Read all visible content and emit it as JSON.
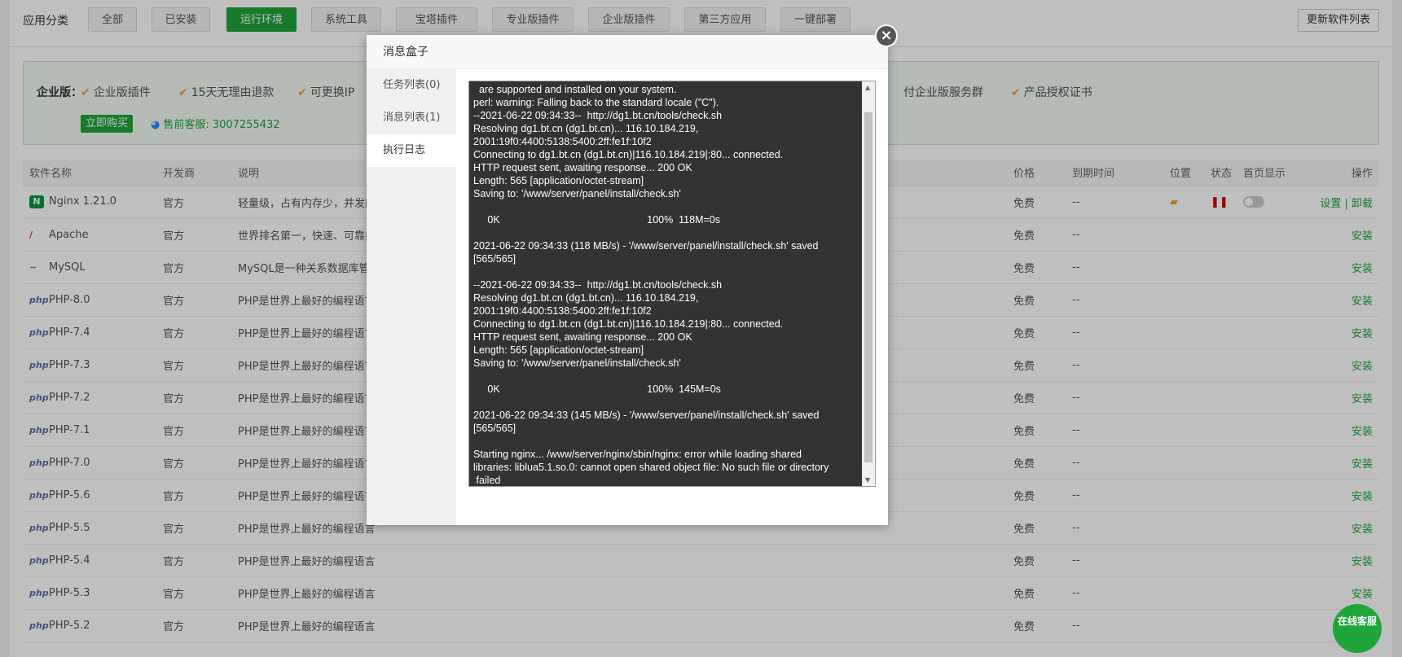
{
  "topbar": {
    "label": "应用分类",
    "categories": [
      "全部",
      "已安装",
      "运行环境",
      "系统工具",
      "宝塔插件",
      "专业版插件",
      "企业版插件",
      "第三方应用",
      "一键部署"
    ],
    "update_button": "更新软件列表"
  },
  "enterprise": {
    "title": "企业版：",
    "features": [
      "企业版插件",
      "15天无理由退款",
      "可更换IP",
      "付企业版服务群",
      "产品授权证书"
    ],
    "buy_button": "立即购买",
    "service": "售前客服: 3007255432"
  },
  "table": {
    "headers": [
      "软件名称",
      "开发商",
      "说明",
      "价格",
      "到期时间",
      "位置",
      "状态",
      "首页显示",
      "操作"
    ],
    "rows": [
      {
        "icon": "N",
        "name": "Nginx 1.21.0",
        "dev": "官方",
        "desc": "轻量级，占有内存少，并发能",
        "price": "免费",
        "expire": "--",
        "action": "设置 | 卸载"
      },
      {
        "icon": "/",
        "name": "Apache",
        "dev": "官方",
        "desc": "世界排名第一，快速、可靠并",
        "price": "免费",
        "expire": "--",
        "action": "安装"
      },
      {
        "icon": "~",
        "name": "MySQL",
        "dev": "官方",
        "desc": "MySQL是一种关系数据库管理",
        "price": "免费",
        "expire": "--",
        "action": "安装"
      },
      {
        "icon": "php",
        "name": "PHP-8.0",
        "dev": "官方",
        "desc": "PHP是世界上最好的编程语言",
        "price": "免费",
        "expire": "--",
        "action": "安装"
      },
      {
        "icon": "php",
        "name": "PHP-7.4",
        "dev": "官方",
        "desc": "PHP是世界上最好的编程语言",
        "price": "免费",
        "expire": "--",
        "action": "安装"
      },
      {
        "icon": "php",
        "name": "PHP-7.3",
        "dev": "官方",
        "desc": "PHP是世界上最好的编程语言",
        "price": "免费",
        "expire": "--",
        "action": "安装"
      },
      {
        "icon": "php",
        "name": "PHP-7.2",
        "dev": "官方",
        "desc": "PHP是世界上最好的编程语言",
        "price": "免费",
        "expire": "--",
        "action": "安装"
      },
      {
        "icon": "php",
        "name": "PHP-7.1",
        "dev": "官方",
        "desc": "PHP是世界上最好的编程语言",
        "price": "免费",
        "expire": "--",
        "action": "安装"
      },
      {
        "icon": "php",
        "name": "PHP-7.0",
        "dev": "官方",
        "desc": "PHP是世界上最好的编程语言",
        "price": "免费",
        "expire": "--",
        "action": "安装"
      },
      {
        "icon": "php",
        "name": "PHP-5.6",
        "dev": "官方",
        "desc": "PHP是世界上最好的编程语言",
        "price": "免费",
        "expire": "--",
        "action": "安装"
      },
      {
        "icon": "php",
        "name": "PHP-5.5",
        "dev": "官方",
        "desc": "PHP是世界上最好的编程语言",
        "price": "免费",
        "expire": "--",
        "action": "安装"
      },
      {
        "icon": "php",
        "name": "PHP-5.4",
        "dev": "官方",
        "desc": "PHP是世界上最好的编程语言",
        "price": "免费",
        "expire": "--",
        "action": "安装"
      },
      {
        "icon": "php",
        "name": "PHP-5.3",
        "dev": "官方",
        "desc": "PHP是世界上最好的编程语言",
        "price": "免费",
        "expire": "--",
        "action": "安装"
      },
      {
        "icon": "php",
        "name": "PHP-5.2",
        "dev": "官方",
        "desc": "PHP是世界上最好的编程语言",
        "price": "免费",
        "expire": "--",
        "action": "安装"
      }
    ]
  },
  "modal": {
    "title": "消息盒子",
    "tabs": [
      "任务列表(0)",
      "消息列表(1)",
      "执行日志"
    ],
    "active_tab": 2,
    "log_lines": [
      "  are supported and installed on your system.",
      "perl: warning: Falling back to the standard locale (\"C\").",
      "--2021-06-22 09:34:33--  http://dg1.bt.cn/tools/check.sh",
      "Resolving dg1.bt.cn (dg1.bt.cn)... 116.10.184.219,",
      "2001:19f0:4400:5138:5400:2ff:fe1f:10f2",
      "Connecting to dg1.bt.cn (dg1.bt.cn)|116.10.184.219|:80... connected.",
      "HTTP request sent, awaiting response... 200 OK",
      "Length: 565 [application/octet-stream]",
      "Saving to: '/www/server/panel/install/check.sh'",
      "",
      "     0K                                                    100%  118M=0s",
      "",
      "2021-06-22 09:34:33 (118 MB/s) - '/www/server/panel/install/check.sh' saved",
      "[565/565]",
      "",
      "--2021-06-22 09:34:33--  http://dg1.bt.cn/tools/check.sh",
      "Resolving dg1.bt.cn (dg1.bt.cn)... 116.10.184.219,",
      "2001:19f0:4400:5138:5400:2ff:fe1f:10f2",
      "Connecting to dg1.bt.cn (dg1.bt.cn)|116.10.184.219|:80... connected.",
      "HTTP request sent, awaiting response... 200 OK",
      "Length: 565 [application/octet-stream]",
      "Saving to: '/www/server/panel/install/check.sh'",
      "",
      "     0K                                                    100%  145M=0s",
      "",
      "2021-06-22 09:34:33 (145 MB/s) - '/www/server/panel/install/check.sh' saved",
      "[565/565]",
      "",
      "Starting nginx... /www/server/nginx/sbin/nginx: error while loading shared",
      "libraries: liblua5.1.so.0: cannot open shared object file: No such file or directory",
      " failed"
    ]
  },
  "online_service": "在线客服",
  "colors": {
    "accent": "#20a53a",
    "check": "#f0a013"
  }
}
